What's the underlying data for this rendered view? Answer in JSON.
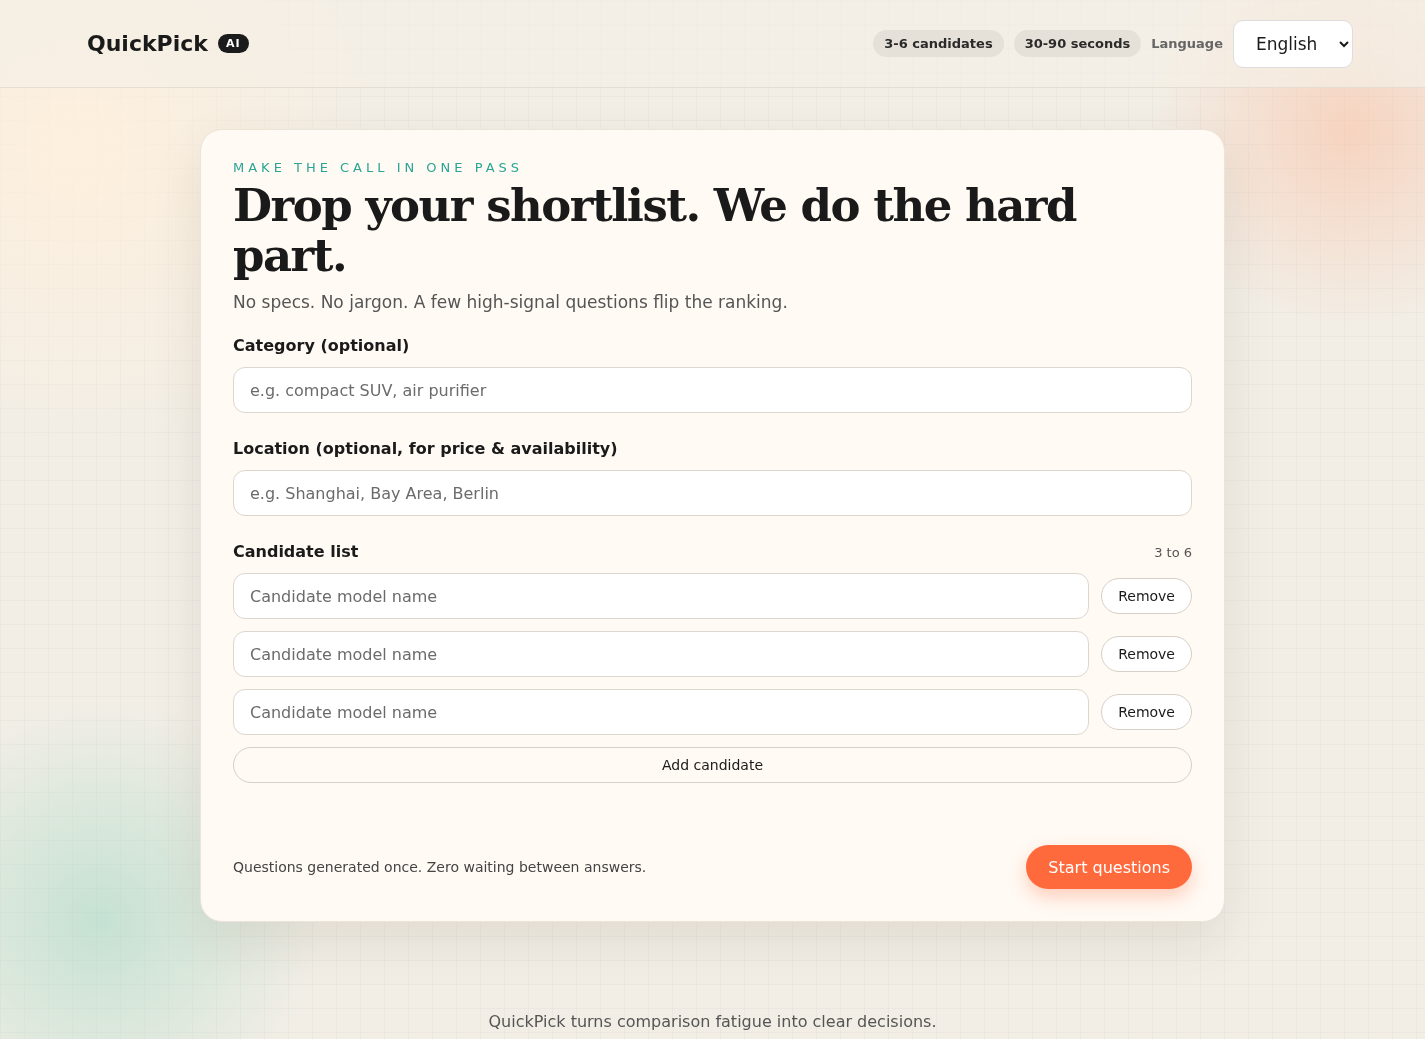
{
  "header": {
    "logo": "QuickPick",
    "badge": "AI",
    "pills": [
      "3-6 candidates",
      "30-90 seconds"
    ],
    "language_label": "Language",
    "language_select": {
      "value": "English"
    }
  },
  "card": {
    "eyebrow": "MAKE THE CALL IN ONE PASS",
    "title": "Drop your shortlist. We do the hard part.",
    "subtitle": "No specs. No jargon. A few high-signal questions flip the ranking.",
    "fields": [
      {
        "label": "Category (optional)",
        "placeholder": "e.g. compact SUV, air purifier"
      },
      {
        "label": "Location (optional, for price & availability)",
        "placeholder": "e.g. Shanghai, Bay Area, Berlin"
      }
    ],
    "candidates": {
      "label": "Candidate list",
      "hint": "3 to 6",
      "rows": [
        {
          "placeholder": "Candidate model name",
          "remove": "Remove"
        },
        {
          "placeholder": "Candidate model name",
          "remove": "Remove"
        },
        {
          "placeholder": "Candidate model name",
          "remove": "Remove"
        }
      ],
      "add_button": "Add candidate"
    },
    "note": "Questions generated once. Zero waiting between answers.",
    "start_button": "Start questions"
  },
  "footer": "QuickPick turns comparison fatigue into clear decisions."
}
